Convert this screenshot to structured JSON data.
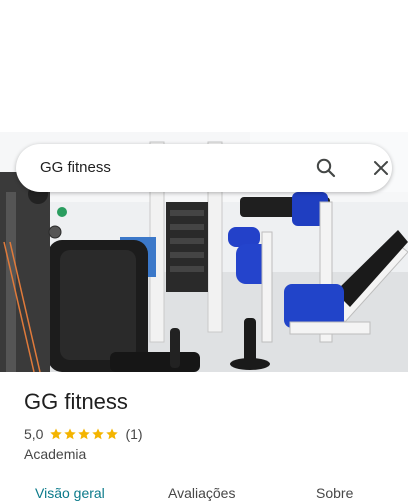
{
  "search": {
    "query": "GG fitness"
  },
  "icons": {
    "search": "search-icon",
    "close": "close-icon",
    "star": "star-icon"
  },
  "place": {
    "name": "GG fitness",
    "rating": "5,0",
    "stars": 5,
    "review_count": "(1)",
    "category": "Academia"
  },
  "tabs": [
    {
      "label": "Visão geral",
      "active": true
    },
    {
      "label": "Avaliações",
      "active": false
    },
    {
      "label": "Sobre",
      "active": false
    }
  ],
  "colors": {
    "star": "#f4b400",
    "active_tab": "#0b7a8a",
    "equipment_blue": "#1f3ec1"
  }
}
